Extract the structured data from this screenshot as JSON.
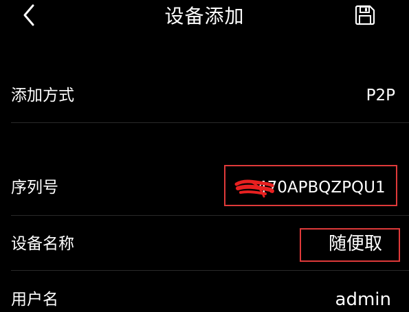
{
  "header": {
    "title": "设备添加",
    "back_icon": "chevron-left-icon",
    "save_icon": "floppy-disk-icon"
  },
  "rows": {
    "add_method": {
      "label": "添加方式",
      "value": "P2P"
    },
    "serial": {
      "label": "序列号",
      "value_visible": "470APBQZPQU1"
    },
    "device_name": {
      "label": "设备名称",
      "value": "随便取"
    },
    "username": {
      "label": "用户名",
      "value": "admin"
    }
  },
  "colors": {
    "background": "#000000",
    "text": "#ffffff",
    "divider": "#2a2a2a",
    "annotation": "#e03a3a",
    "redaction": "#e82020"
  }
}
